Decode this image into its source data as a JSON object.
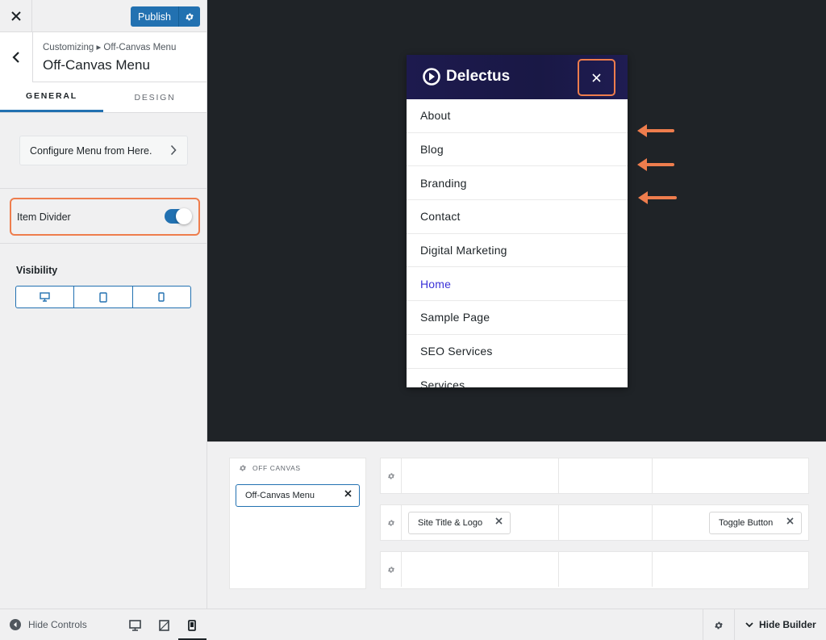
{
  "topbar": {
    "close_icon": "close-icon",
    "publish_label": "Publish",
    "publish_gear_icon": "gear-icon"
  },
  "section": {
    "back_icon": "chevron-left-icon",
    "breadcrumb": "Customizing ▸ Off-Canvas Menu",
    "title": "Off-Canvas Menu"
  },
  "tabs": [
    {
      "label": "GENERAL",
      "active": true
    },
    {
      "label": "DESIGN",
      "active": false
    }
  ],
  "controls": {
    "configure_label": "Configure Menu from Here.",
    "item_divider_label": "Item Divider",
    "item_divider_on": true,
    "visibility_label": "Visibility",
    "visibility_devices": [
      "desktop-icon",
      "tablet-icon",
      "mobile-icon"
    ]
  },
  "bottom_left": {
    "hide_controls_label": "Hide Controls",
    "devices": [
      "desktop-icon",
      "tablet-icon",
      "mobile-icon"
    ],
    "active_device": "mobile"
  },
  "preview": {
    "logo_text": "Delectus",
    "close_icon": "close-icon",
    "menu_items": [
      {
        "label": "About",
        "current": false
      },
      {
        "label": "Blog",
        "current": false
      },
      {
        "label": "Branding",
        "current": false
      },
      {
        "label": "Contact",
        "current": false
      },
      {
        "label": "Digital Marketing",
        "current": false
      },
      {
        "label": "Home",
        "current": true
      },
      {
        "label": "Sample Page",
        "current": false
      },
      {
        "label": "SEO Services",
        "current": false
      },
      {
        "label": "Services",
        "current": false
      }
    ],
    "annotation_color": "#ee7d4d",
    "accent_color": "#2271b1"
  },
  "builder": {
    "off_canvas_label": "OFF CANVAS",
    "off_canvas_chip": "Off-Canvas Menu",
    "row2_left_chip": "Site Title & Logo",
    "row2_right_chip": "Toggle Button",
    "hide_builder_label": "Hide Builder"
  }
}
